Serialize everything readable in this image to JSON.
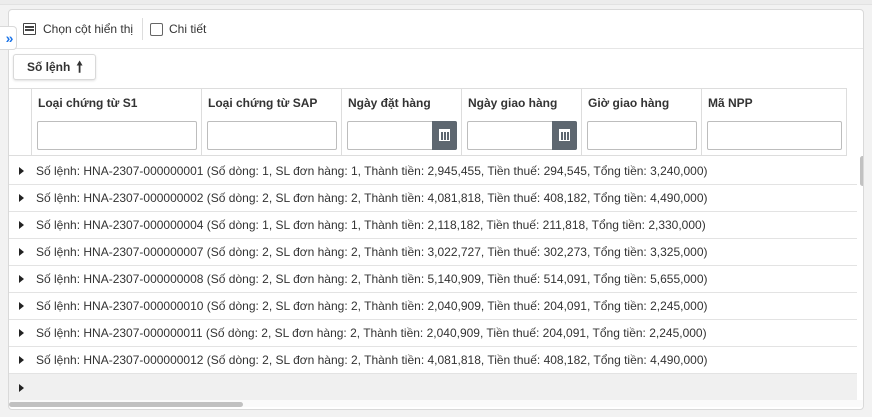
{
  "toolbar": {
    "choose_columns_label": "Chọn cột hiển thị",
    "detail_label": "Chi tiết"
  },
  "group_by": {
    "label": "Số lệnh"
  },
  "columns": [
    {
      "label": "Loại chứng từ S1"
    },
    {
      "label": "Loại chứng từ SAP"
    },
    {
      "label": "Ngày đặt hàng"
    },
    {
      "label": "Ngày giao hàng"
    },
    {
      "label": "Giờ giao hàng"
    },
    {
      "label": "Mã NPP"
    }
  ],
  "groups": [
    "Số lệnh: HNA-2307-000000001 (Số dòng: 1, SL đơn hàng: 1, Thành tiền: 2,945,455, Tiền thuế: 294,545, Tổng tiền: 3,240,000)",
    "Số lệnh: HNA-2307-000000002 (Số dòng: 2, SL đơn hàng: 2, Thành tiền: 4,081,818, Tiền thuế: 408,182, Tổng tiền: 4,490,000)",
    "Số lệnh: HNA-2307-000000004 (Số dòng: 1, SL đơn hàng: 1, Thành tiền: 2,118,182, Tiền thuế: 211,818, Tổng tiền: 2,330,000)",
    "Số lệnh: HNA-2307-000000007 (Số dòng: 2, SL đơn hàng: 2, Thành tiền: 3,022,727, Tiền thuế: 302,273, Tổng tiền: 3,325,000)",
    "Số lệnh: HNA-2307-000000008 (Số dòng: 2, SL đơn hàng: 2, Thành tiền: 5,140,909, Tiền thuế: 514,091, Tổng tiền: 5,655,000)",
    "Số lệnh: HNA-2307-000000010 (Số dòng: 2, SL đơn hàng: 2, Thành tiền: 2,040,909, Tiền thuế: 204,091, Tổng tiền: 2,245,000)",
    "Số lệnh: HNA-2307-000000011 (Số dòng: 2, SL đơn hàng: 2, Thành tiền: 2,040,909, Tiền thuế: 204,091, Tổng tiền: 2,245,000)",
    "Số lệnh: HNA-2307-000000012 (Số dòng: 2, SL đơn hàng: 2, Thành tiền: 4,081,818, Tiền thuế: 408,182, Tổng tiền: 4,490,000)"
  ],
  "icons": {
    "expand": "double-chevron-right-icon",
    "choose_columns": "column-chooser-icon",
    "sort": "arrow-up-icon",
    "calendar": "calendar-icon",
    "row_expand": "triangle-right-icon"
  },
  "colors": {
    "accent": "#1a73e8",
    "calendar_button": "#5e6770"
  }
}
